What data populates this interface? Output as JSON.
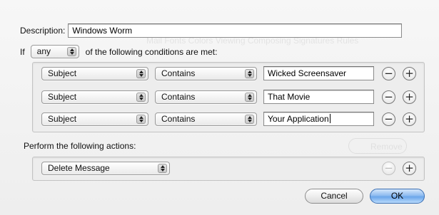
{
  "dialog": {
    "description_label": "Description:",
    "description_value": "Windows Worm",
    "if_label": "If",
    "match_mode": "any",
    "conditions_suffix": "of the following conditions are met:",
    "conditions": [
      {
        "field": "Subject",
        "operator": "Contains",
        "value": "Wicked Screensaver"
      },
      {
        "field": "Subject",
        "operator": "Contains",
        "value": "That Movie"
      },
      {
        "field": "Subject",
        "operator": "Contains",
        "value": "Your Application"
      }
    ],
    "actions_label": "Perform the following actions:",
    "actions": [
      {
        "action": "Delete Message"
      }
    ],
    "remove_symbol": "−",
    "add_symbol": "+",
    "cancel_label": "Cancel",
    "ok_label": "OK"
  },
  "background_window": {
    "toolbar_text": "Mail  Fonts  Colors  Viewing  Composing  Signatures  Rules",
    "remove_button": "Remove"
  },
  "colors": {
    "default_button": "#6aa6ea",
    "sheet_background": "#eeeeee"
  }
}
